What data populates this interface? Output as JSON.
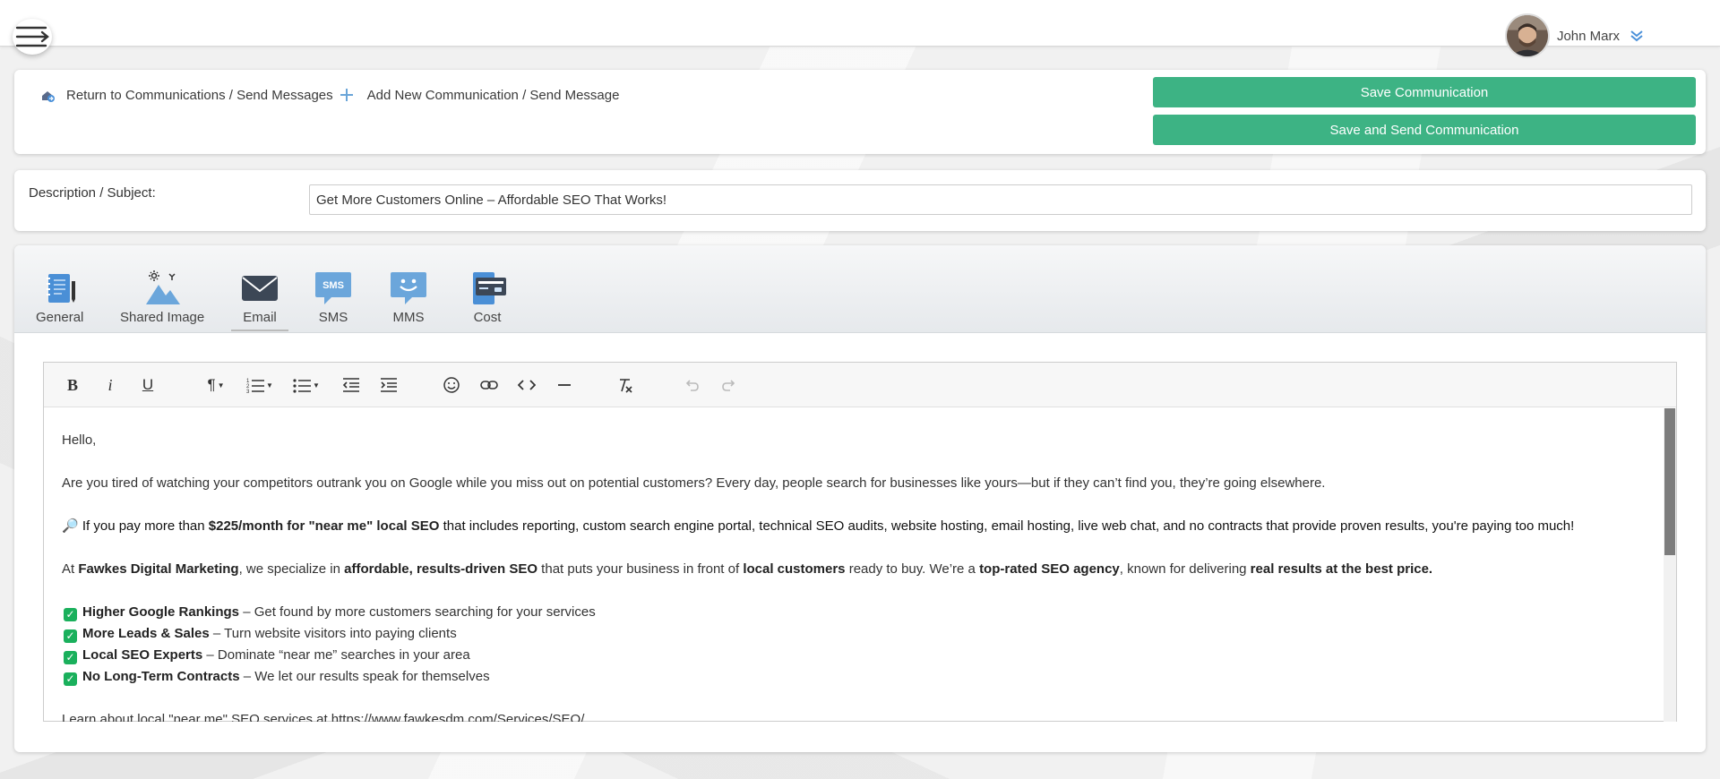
{
  "header": {
    "menu_icon": "hamburger-menu-icon",
    "user_name": "John Marx",
    "user_menu_icon": "chevron-down-icon"
  },
  "actions": {
    "return_link": "Return to Communications / Send Messages",
    "add_link": "Add New Communication / Send Message",
    "save_label": "Save Communication",
    "save_send_label": "Save and Send Communication",
    "button_color": "#3db384"
  },
  "subject": {
    "label": "Description / Subject:",
    "value": "Get More Customers Online – Affordable SEO That Works!"
  },
  "tabs": [
    {
      "label": "General",
      "icon": "notebook-icon"
    },
    {
      "label": "Shared Image",
      "icon": "landscape-image-icon"
    },
    {
      "label": "Email",
      "icon": "envelope-icon"
    },
    {
      "label": "SMS",
      "icon": "sms-bubble-icon"
    },
    {
      "label": "MMS",
      "icon": "mms-smiley-bubble-icon"
    },
    {
      "label": "Cost",
      "icon": "wallet-icon"
    }
  ],
  "active_tab": "Email",
  "editor": {
    "greeting": "Hello,",
    "para1": "Are you tired of watching your competitors outrank you on Google while you miss out on potential customers? Every day, people search for businesses like yours—but if they can’t find you, they’re going elsewhere.",
    "para2_emoji": "🔎",
    "para2_a": "If you pay more than ",
    "para2_b": "$225/month for \"near me\" local SEO",
    "para2_c": " that includes reporting, custom search engine portal, technical SEO audits, website hosting, email hosting, live web chat, and no contracts that provide proven results, you're paying too much!",
    "para3_a": "At ",
    "para3_b": "Fawkes Digital Marketing",
    "para3_c": ", we specialize in ",
    "para3_d": "affordable, results-driven SEO",
    "para3_e": " that puts your business in front of ",
    "para3_f": "local customers",
    "para3_g": " ready to buy. We’re a ",
    "para3_h": "top-rated SEO agency",
    "para3_i": ", known for delivering ",
    "para3_j": "real results at the best price.",
    "list": [
      {
        "bold": "Higher Google Rankings",
        "text": " – Get found by more customers searching for your services"
      },
      {
        "bold": "More Leads & Sales",
        "text": " – Turn website visitors into paying clients"
      },
      {
        "bold": "Local SEO Experts",
        "text": " – Dominate “near me” searches in your area"
      },
      {
        "bold": "No Long-Term Contracts",
        "text": " – We let our results speak for themselves"
      }
    ],
    "para4": "Learn about local \"near me\" SEO services at https://www.fawkesdm.com/Services/SEO/"
  },
  "toolbar": [
    "bold-icon",
    "italic-icon",
    "underline-icon",
    "paragraph-format-icon",
    "ordered-list-icon",
    "unordered-list-icon",
    "outdent-icon",
    "indent-icon",
    "emoticon-icon",
    "link-icon",
    "code-view-icon",
    "horizontal-line-icon",
    "clear-format-icon",
    "undo-icon",
    "redo-icon"
  ]
}
